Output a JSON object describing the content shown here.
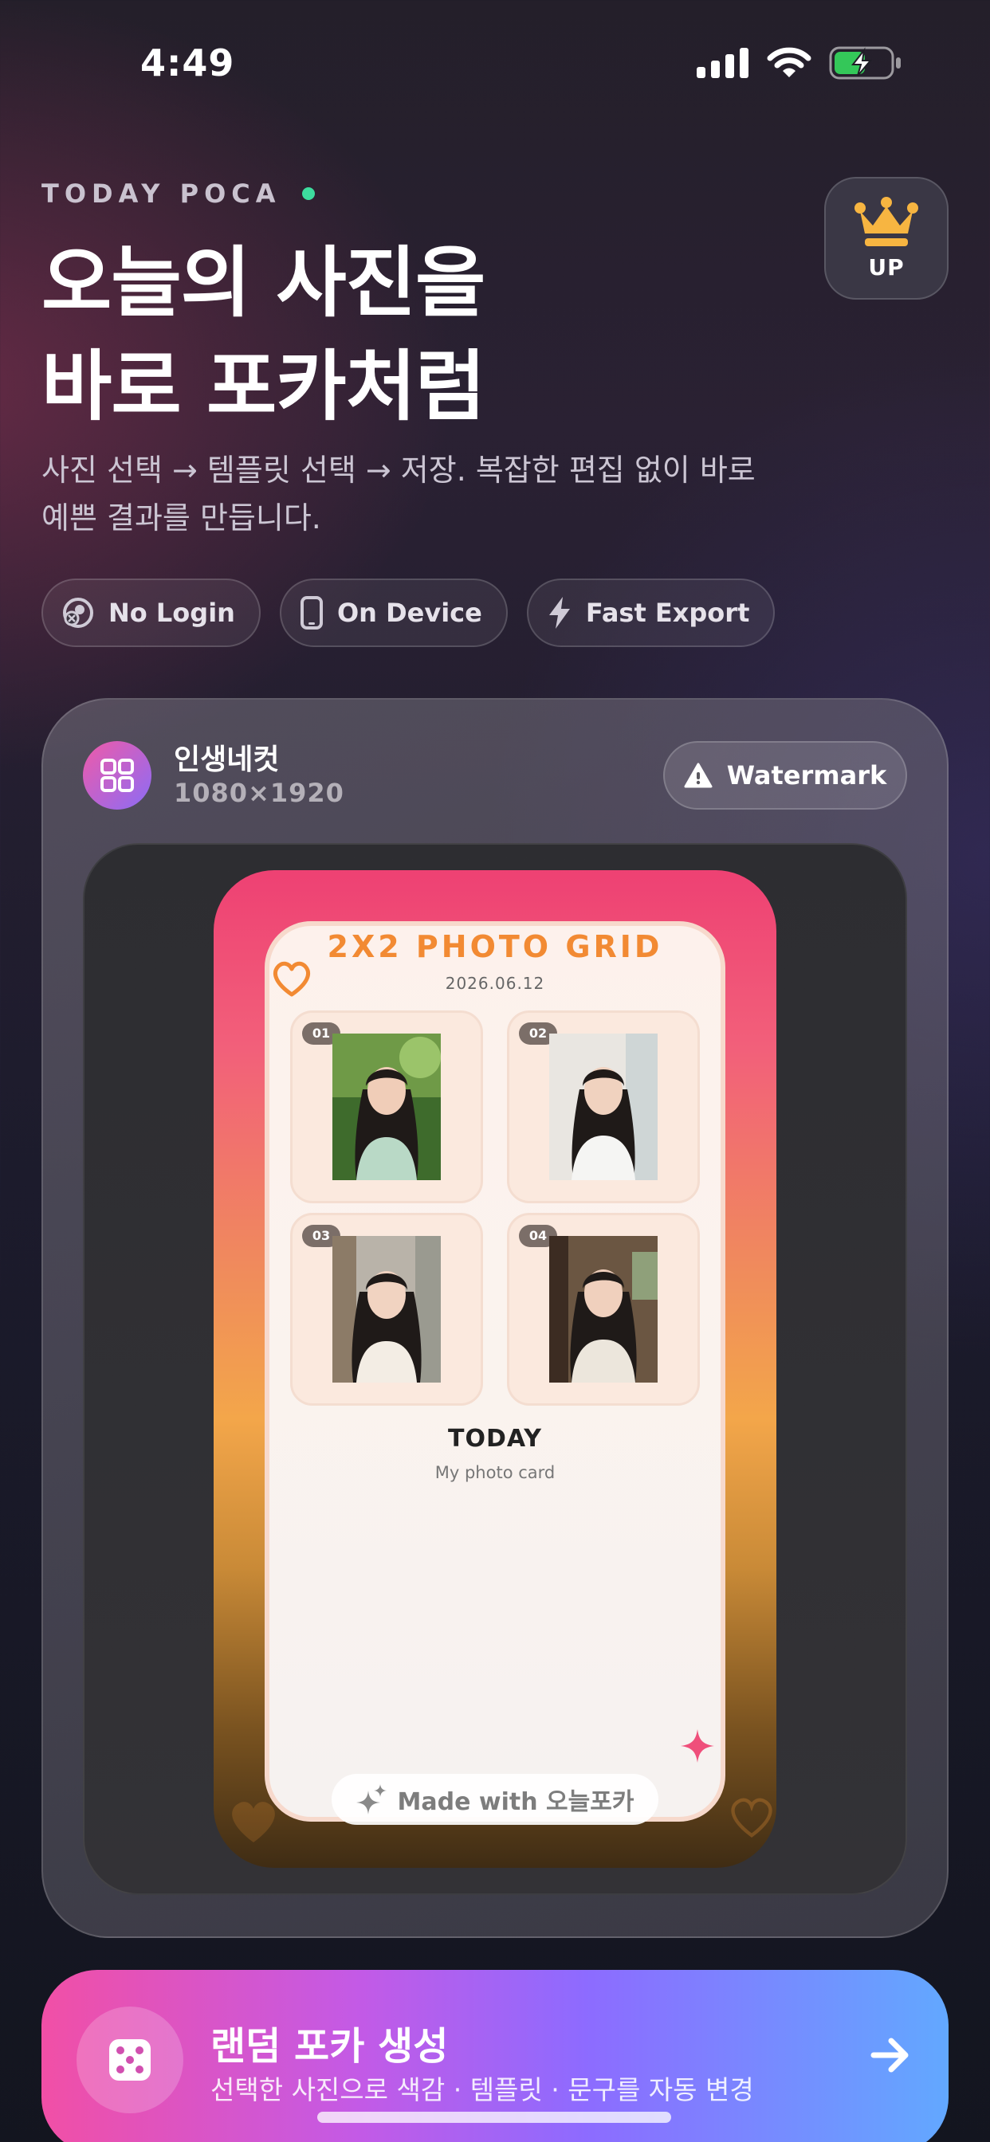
{
  "status_bar": {
    "time": "4:49"
  },
  "header": {
    "eyebrow": "TODAY POCA",
    "title_line1": "오늘의 사진을",
    "title_line2": "바로 포카처럼",
    "subtitle_line1": "사진 선택 → 템플릿 선택 → 저장. 복잡한 편집 없이 바로",
    "subtitle_line2": "예쁜 결과를 만듭니다.",
    "upgrade_label": "UP"
  },
  "chips": [
    {
      "label": "No Login",
      "icon": "no-login-icon"
    },
    {
      "label": "On Device",
      "icon": "phone-icon"
    },
    {
      "label": "Fast Export",
      "icon": "bolt-icon"
    }
  ],
  "template": {
    "name": "인생네컷",
    "size": "1080×1920",
    "watermark_label": "Watermark"
  },
  "photocard": {
    "title": "2X2 PHOTO GRID",
    "date": "2026.06.12",
    "slots": [
      "01",
      "02",
      "03",
      "04"
    ],
    "caption_title": "TODAY",
    "caption_sub": "My photo card",
    "made_with": "Made with 오늘포카"
  },
  "cta": {
    "title": "랜덤 포카 생성",
    "subtitle": "선택한 사진으로 색감 · 템플릿 · 문구를 자동 변경"
  },
  "colors": {
    "accent_dot": "#3ddc9e",
    "crown": "#f7b541",
    "card_title": "#f28a33",
    "sparkle": "#ef4f7b"
  }
}
